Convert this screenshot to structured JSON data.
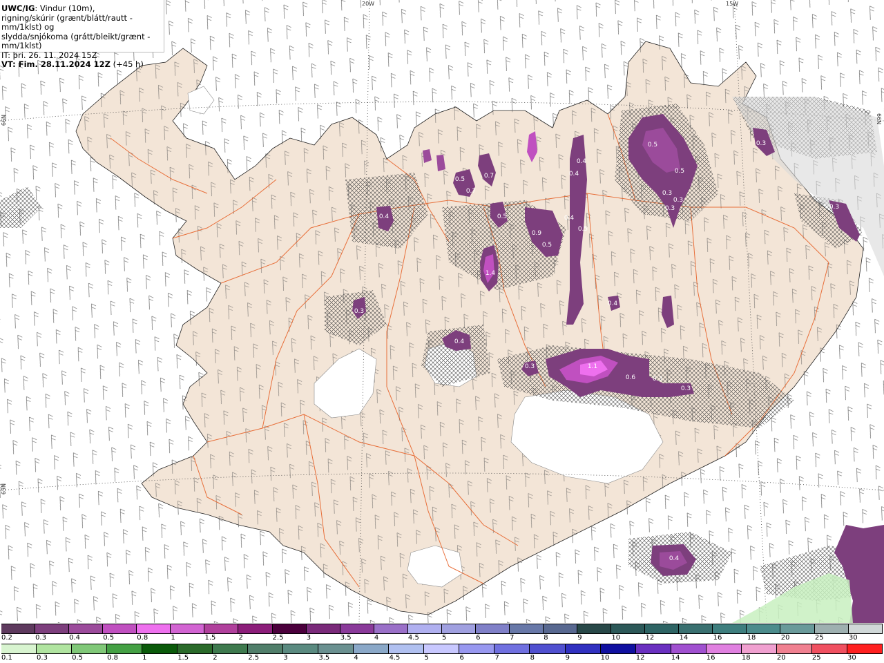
{
  "header": {
    "model": "UWC/IG",
    "line1_rest": ": Vindur (10m),",
    "line2": "rigning/skúrir (grænt/blátt/rautt - mm/1klst) og",
    "line3": "slydda/snjókoma (grátt/bleikt/grænt - mm/1klst)",
    "line4": "IT: þri. 26. 11. 2024 15Z",
    "vt_bold": "VT: Fim. 28.11.2024 12Z",
    "vt_rest": " (+45 h)"
  },
  "grid_labels": {
    "lon20": "20W",
    "lon15": "15W",
    "lat66": "66N",
    "lat65": "65N",
    "lat66r": "66N"
  },
  "values": [
    "0.5",
    "0.5",
    "0.4",
    "0.4",
    "0.3",
    "0.3",
    "0.3",
    "0.7",
    "0.7",
    "0.5",
    "0.5",
    "0.9",
    "0.5",
    "0.4",
    "0.4",
    "0.5",
    "1.4",
    "0.3",
    "0.4",
    "0.4",
    "1.1",
    "0.6",
    "0.3",
    "0.3",
    "0.3",
    "0.3",
    "0.3",
    "0.4"
  ],
  "colors": {
    "land": "#f3e5d7",
    "roads": "#e65a1e",
    "ice": "#ffffff",
    "sea": "#ffffff"
  },
  "legend": {
    "snow_labels": [
      "0.2",
      "0.3",
      "0.4",
      "0.5",
      "0.8",
      "1",
      "1.5",
      "2",
      "2.5",
      "3",
      "3.5",
      "4",
      "4.5",
      "5",
      "6",
      "7",
      "8",
      "9",
      "10",
      "12",
      "14",
      "16",
      "18",
      "20",
      "25",
      "30"
    ],
    "snow_colors": [
      "#5e3a5e",
      "#7d3f7d",
      "#9b4b9b",
      "#c050c0",
      "#ee70ee",
      "#d264d2",
      "#b0409c",
      "#8c1e7a",
      "#4b003c",
      "#7a2a7a",
      "#8a3a9a",
      "#9a70c8",
      "#b0b0f0",
      "#a0a0e0",
      "#8080c8",
      "#6878a8",
      "#586890",
      "#284848",
      "#2c5858",
      "#2e6464",
      "#3a7070",
      "#3e7e7e",
      "#4c8c8c",
      "#6a9a9a",
      "#9eb0b0",
      "#d0d8d8"
    ],
    "rain_labels": [
      "0.1",
      "0.3",
      "0.5",
      "0.8",
      "1",
      "1.5",
      "2",
      "2.5",
      "3",
      "3.5",
      "4",
      "4.5",
      "5",
      "6",
      "7",
      "8",
      "9",
      "10",
      "12",
      "14",
      "16",
      "18",
      "20",
      "25",
      "30"
    ],
    "rain_colors": [
      "#d8f4d0",
      "#b0e4a0",
      "#80c878",
      "#44a044",
      "#0a5a0a",
      "#2a6a2a",
      "#3e7a4e",
      "#507e6a",
      "#5a8a80",
      "#6a9090",
      "#8aa8c8",
      "#b0c0f0",
      "#c8c8ff",
      "#9898f0",
      "#7070e0",
      "#5050d0",
      "#3030c0",
      "#1010a0",
      "#6a30c0",
      "#a050d0",
      "#e080e0",
      "#f0a0d0",
      "#f08090",
      "#f05060",
      "#ff2020"
    ]
  }
}
